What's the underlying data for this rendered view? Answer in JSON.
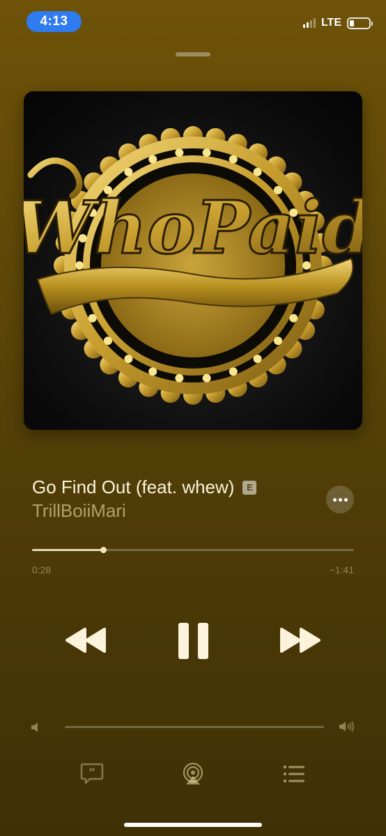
{
  "status_bar": {
    "time": "4:13",
    "network": "LTE",
    "signal_bars_filled": 2,
    "signal_bars_total": 4,
    "battery_level": 0.2
  },
  "artwork": {
    "logo_text": "WhoPaid",
    "colors": {
      "gold": "#d4a62a",
      "gold_light": "#f3d778",
      "gold_dark": "#7a5a10",
      "background": "#0c0c0c"
    }
  },
  "track": {
    "title": "Go Find Out (feat. whew)",
    "explicit_badge": "E",
    "artist": "TrillBoiiMari"
  },
  "playback": {
    "elapsed": "0:28",
    "remaining": "−1:41",
    "progress": 0.22,
    "state": "playing"
  },
  "volume": {
    "level": 0.0
  },
  "icons": {
    "more": "ellipsis-icon",
    "rewind": "rewind-icon",
    "pause": "pause-icon",
    "forward": "fast-forward-icon",
    "volume_low": "speaker-low-icon",
    "volume_high": "speaker-high-icon",
    "lyrics": "lyrics-quote-bubble-icon",
    "airplay": "airplay-icon",
    "queue": "queue-list-icon"
  },
  "colors": {
    "background_top": "#6e5208",
    "background_bottom": "#3f3006",
    "time_pill": "#2f7bf0"
  }
}
